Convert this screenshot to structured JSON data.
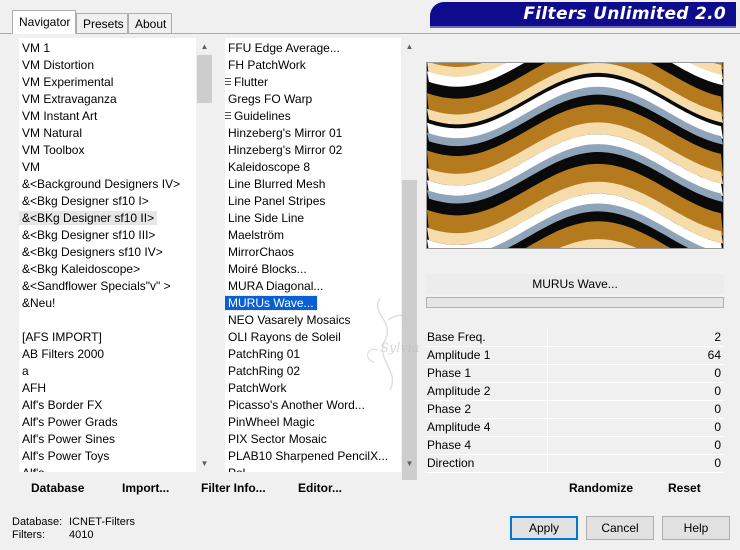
{
  "tabs": [
    "Navigator",
    "Presets",
    "About"
  ],
  "banner": "Filters Unlimited 2.0",
  "categories": [
    "VM 1",
    "VM Distortion",
    "VM Experimental",
    "VM Extravaganza",
    "VM Instant Art",
    "VM Natural",
    "VM Toolbox",
    "VM",
    "&<Background Designers IV>",
    "&<Bkg Designer sf10 I>",
    "&<BKg Designer sf10 II>",
    "&<Bkg Designer sf10 III>",
    "&<Bkg Designers sf10 IV>",
    "&<Bkg Kaleidoscope>",
    "&<Sandflower Specials\"v\" >",
    "&Neu!",
    "",
    "[AFS IMPORT]",
    "AB Filters 2000",
    "a",
    "AFH",
    "Alf's Border FX",
    "Alf's Power Grads",
    "Alf's Power Sines",
    "Alf's Power Toys",
    "Alf's ..."
  ],
  "filters": [
    "FFU Edge Average...",
    "FH PatchWork",
    "Flutter",
    "Gregs FO Warp",
    "Guidelines",
    "Hinzeberg's Mirror 01",
    "Hinzeberg's Mirror 02",
    "Kaleidoscope 8",
    "Line Blurred Mesh",
    "Line Panel Stripes",
    "Line Side Line",
    "Maelström",
    "MirrorChaos",
    "Moiré Blocks...",
    "MURA Diagonal...",
    "MURUs Wave...",
    "NEO Vasarely Mosaics",
    "OLI Rayons de Soleil",
    "PatchRing 01",
    "PatchRing 02",
    "PatchWork",
    "Picasso's Another Word...",
    "PinWheel Magic",
    "PIX Sector Mosaic",
    "PLAB10 Sharpened PencilX...",
    "Pol..."
  ],
  "selected_category_index": 10,
  "selected_filter_index": 15,
  "grip_filter_indices": [
    2,
    4
  ],
  "selected_filter_name": "MURUs Wave...",
  "params": [
    {
      "name": "Base Freq.",
      "value": "2"
    },
    {
      "name": "Amplitude 1",
      "value": "64"
    },
    {
      "name": "Phase 1",
      "value": "0"
    },
    {
      "name": "Amplitude 2",
      "value": "0"
    },
    {
      "name": "Phase 2",
      "value": "0"
    },
    {
      "name": "Amplitude 4",
      "value": "0"
    },
    {
      "name": "Phase 4",
      "value": "0"
    },
    {
      "name": "Direction",
      "value": "0"
    }
  ],
  "toolbar": {
    "database": "Database",
    "import": "Import...",
    "filter_info": "Filter Info...",
    "editor": "Editor...",
    "randomize": "Randomize",
    "reset": "Reset"
  },
  "status": {
    "database_label": "Database:",
    "database_value": "ICNET-Filters",
    "filters_label": "Filters:",
    "filters_value": "4010"
  },
  "buttons": {
    "apply": "Apply",
    "cancel": "Cancel",
    "help": "Help"
  },
  "watermark": "Sylvia",
  "colors": {
    "banner": "#0e0b8c",
    "selection": "#0a5fd4",
    "wave_gold": "#b57a1e",
    "wave_cream": "#f6dcaa"
  }
}
